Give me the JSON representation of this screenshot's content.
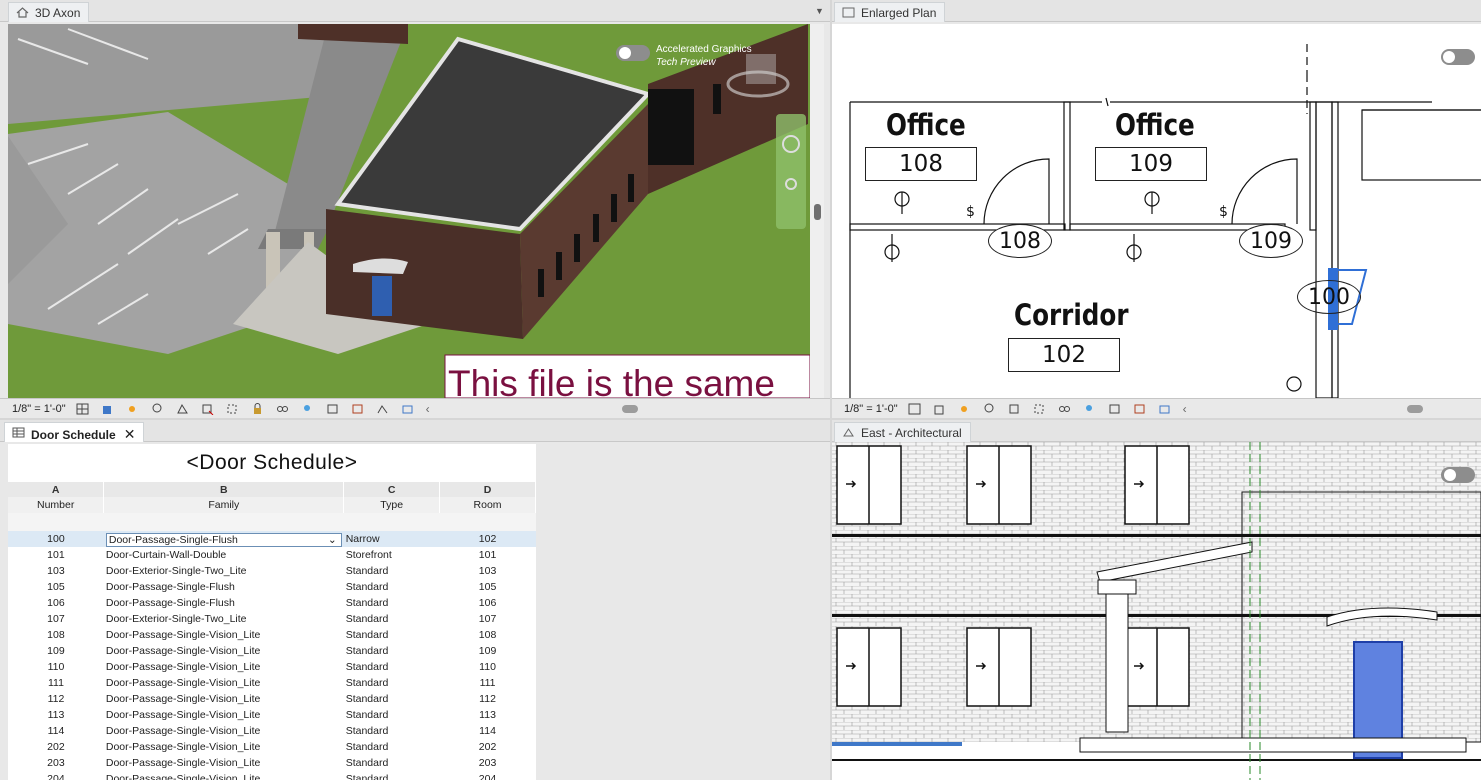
{
  "views": {
    "axon": {
      "tab_label": "3D Axon",
      "scale": "1/8\" = 1'-0\"",
      "overlay_line1": "Accelerated Graphics",
      "overlay_line2": "Tech Preview",
      "banner_text": "This file is the same"
    },
    "plan": {
      "tab_label": "Enlarged Plan",
      "scale": "1/8\" = 1'-0\"",
      "rooms": [
        {
          "name": "Office",
          "number": "108"
        },
        {
          "name": "Office",
          "number": "109"
        },
        {
          "name": "Corridor",
          "number": "102"
        }
      ],
      "door_tags": [
        "108",
        "109",
        "100"
      ]
    },
    "schedule": {
      "tab_label": "Door Schedule",
      "close_glyph": "✕"
    },
    "elevation": {
      "tab_label": "East - Architectural"
    }
  },
  "schedule": {
    "title": "<Door Schedule>",
    "column_letters": [
      "A",
      "B",
      "C",
      "D"
    ],
    "column_fields": [
      "Number",
      "Family",
      "Type",
      "Room"
    ],
    "rows": [
      {
        "number": "100",
        "family": "Door-Passage-Single-Flush",
        "type": "Narrow",
        "room": "102",
        "selected": true
      },
      {
        "number": "101",
        "family": "Door-Curtain-Wall-Double",
        "type": "Storefront",
        "room": "101"
      },
      {
        "number": "103",
        "family": "Door-Exterior-Single-Two_Lite",
        "type": "Standard",
        "room": "103"
      },
      {
        "number": "105",
        "family": "Door-Passage-Single-Flush",
        "type": "Standard",
        "room": "105"
      },
      {
        "number": "106",
        "family": "Door-Passage-Single-Flush",
        "type": "Standard",
        "room": "106"
      },
      {
        "number": "107",
        "family": "Door-Exterior-Single-Two_Lite",
        "type": "Standard",
        "room": "107"
      },
      {
        "number": "108",
        "family": "Door-Passage-Single-Vision_Lite",
        "type": "Standard",
        "room": "108"
      },
      {
        "number": "109",
        "family": "Door-Passage-Single-Vision_Lite",
        "type": "Standard",
        "room": "109"
      },
      {
        "number": "110",
        "family": "Door-Passage-Single-Vision_Lite",
        "type": "Standard",
        "room": "110"
      },
      {
        "number": "111",
        "family": "Door-Passage-Single-Vision_Lite",
        "type": "Standard",
        "room": "111"
      },
      {
        "number": "112",
        "family": "Door-Passage-Single-Vision_Lite",
        "type": "Standard",
        "room": "112"
      },
      {
        "number": "113",
        "family": "Door-Passage-Single-Vision_Lite",
        "type": "Standard",
        "room": "113"
      },
      {
        "number": "114",
        "family": "Door-Passage-Single-Vision_Lite",
        "type": "Standard",
        "room": "114"
      },
      {
        "number": "202",
        "family": "Door-Passage-Single-Vision_Lite",
        "type": "Standard",
        "room": "202"
      },
      {
        "number": "203",
        "family": "Door-Passage-Single-Vision_Lite",
        "type": "Standard",
        "room": "203"
      },
      {
        "number": "204",
        "family": "Door-Passage-Single-Vision_Lite",
        "type": "Standard",
        "room": "204"
      }
    ]
  },
  "colors": {
    "grass": "#6f9a3a",
    "brick": "#4a2f28",
    "roof": "#3a3a3a",
    "banner_text": "#7a1040",
    "selection_blue": "#2f6fd6"
  }
}
